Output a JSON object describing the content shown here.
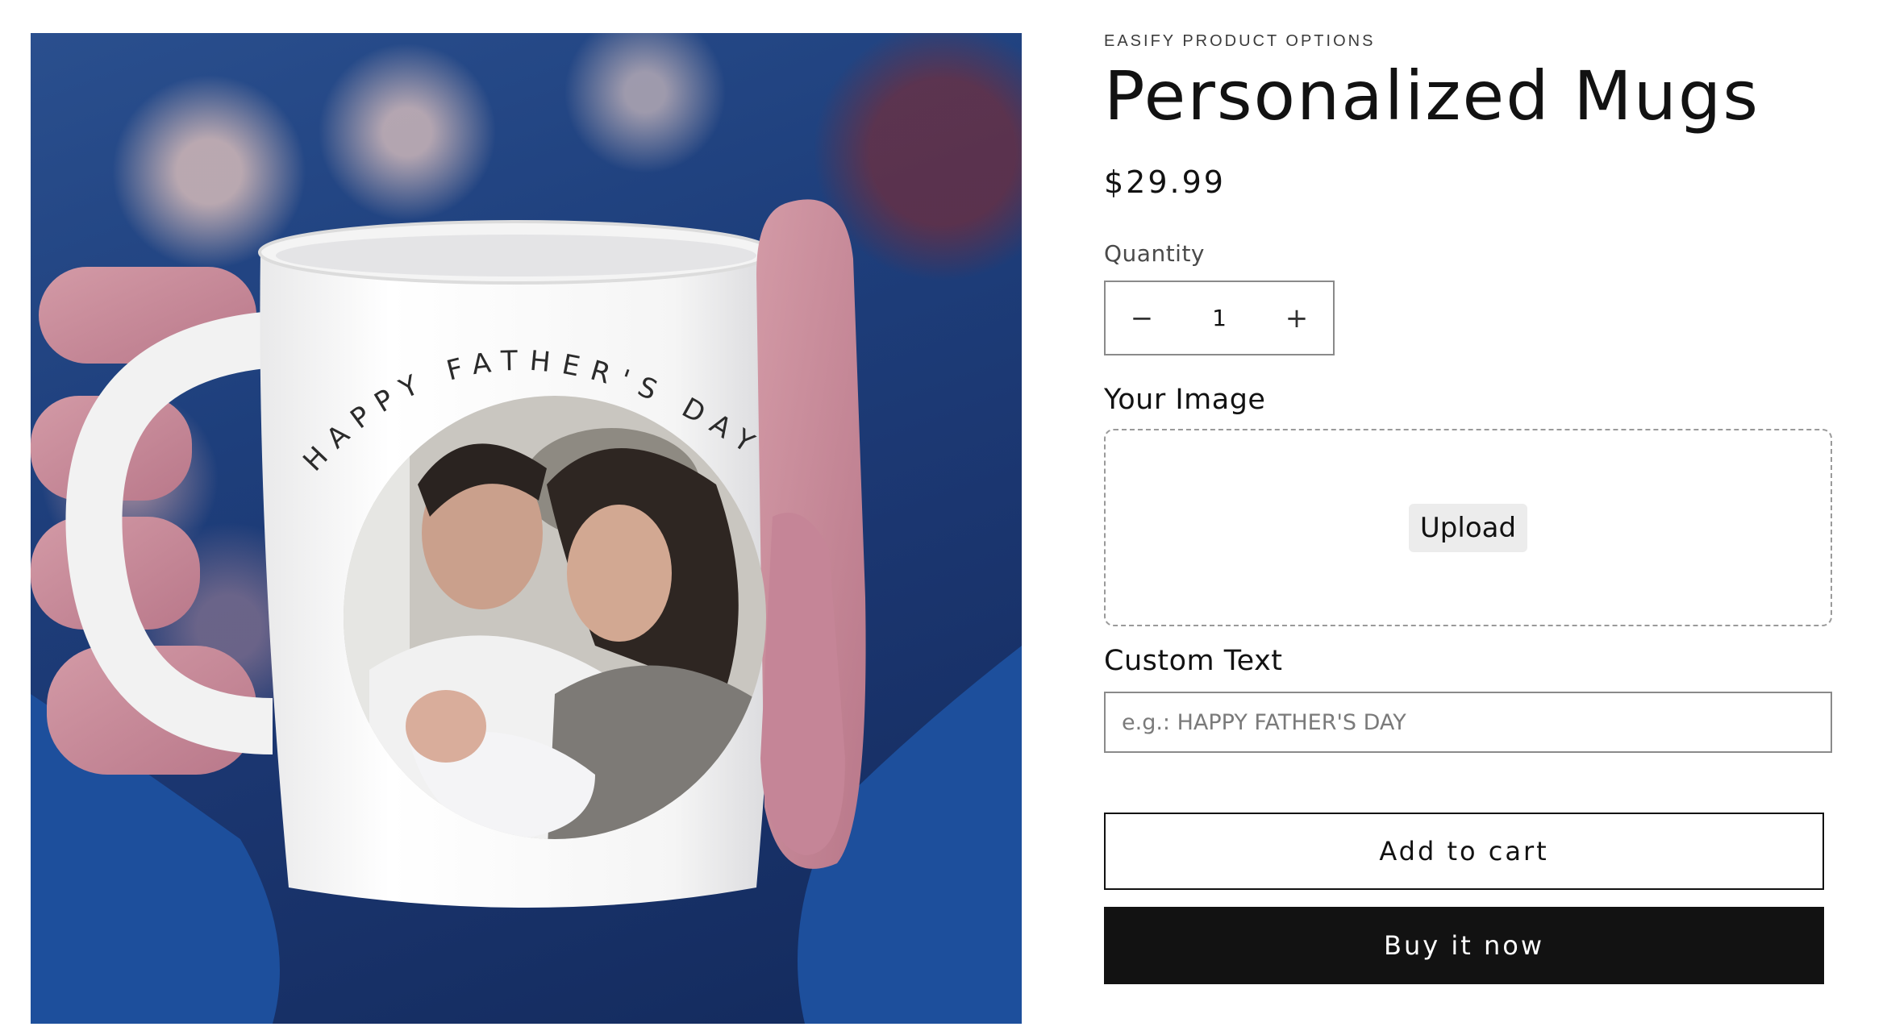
{
  "product": {
    "vendor": "EASIFY PRODUCT OPTIONS",
    "title": "Personalized Mugs",
    "price": "$29.99"
  },
  "media": {
    "mug_print_text": "HAPPY FATHER'S DAY"
  },
  "quantity": {
    "label": "Quantity",
    "value": "1",
    "decrease_symbol": "−",
    "increase_symbol": "+"
  },
  "options": {
    "image_label": "Your Image",
    "upload_label": "Upload",
    "text_label": "Custom Text",
    "text_placeholder": "e.g.: HAPPY FATHER'S DAY"
  },
  "actions": {
    "add_to_cart": "Add to cart",
    "buy_now": "Buy it now"
  },
  "colors": {
    "primary": "#121212",
    "background": "#ffffff",
    "border": "#8a8a8a"
  }
}
